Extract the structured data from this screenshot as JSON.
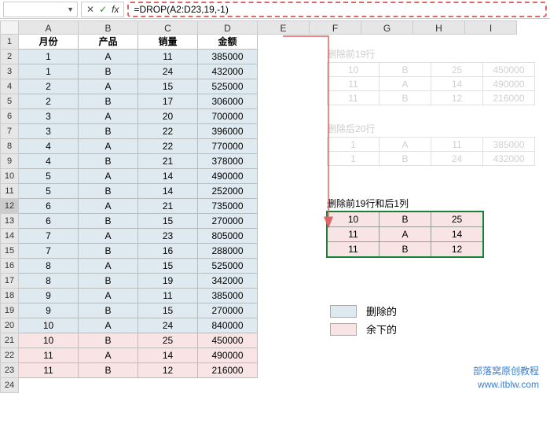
{
  "formula_bar": {
    "name_box": "",
    "fx_label": "fx",
    "formula": "=DROP(A2:D23,19,-1)"
  },
  "col_headers": [
    "A",
    "B",
    "C",
    "D",
    "E",
    "F",
    "G",
    "H",
    "I"
  ],
  "headers": {
    "c1": "月份",
    "c2": "产品",
    "c3": "销量",
    "c4": "金额"
  },
  "main_rows": [
    {
      "m": "1",
      "p": "A",
      "s": "11",
      "a": "385000",
      "cls": "blue"
    },
    {
      "m": "1",
      "p": "B",
      "s": "24",
      "a": "432000",
      "cls": "blue"
    },
    {
      "m": "2",
      "p": "A",
      "s": "15",
      "a": "525000",
      "cls": "blue"
    },
    {
      "m": "2",
      "p": "B",
      "s": "17",
      "a": "306000",
      "cls": "blue"
    },
    {
      "m": "3",
      "p": "A",
      "s": "20",
      "a": "700000",
      "cls": "blue"
    },
    {
      "m": "3",
      "p": "B",
      "s": "22",
      "a": "396000",
      "cls": "blue"
    },
    {
      "m": "4",
      "p": "A",
      "s": "22",
      "a": "770000",
      "cls": "blue"
    },
    {
      "m": "4",
      "p": "B",
      "s": "21",
      "a": "378000",
      "cls": "blue"
    },
    {
      "m": "5",
      "p": "A",
      "s": "14",
      "a": "490000",
      "cls": "blue"
    },
    {
      "m": "5",
      "p": "B",
      "s": "14",
      "a": "252000",
      "cls": "blue"
    },
    {
      "m": "6",
      "p": "A",
      "s": "21",
      "a": "735000",
      "cls": "blue"
    },
    {
      "m": "6",
      "p": "B",
      "s": "15",
      "a": "270000",
      "cls": "blue"
    },
    {
      "m": "7",
      "p": "A",
      "s": "23",
      "a": "805000",
      "cls": "blue"
    },
    {
      "m": "7",
      "p": "B",
      "s": "16",
      "a": "288000",
      "cls": "blue"
    },
    {
      "m": "8",
      "p": "A",
      "s": "15",
      "a": "525000",
      "cls": "blue"
    },
    {
      "m": "8",
      "p": "B",
      "s": "19",
      "a": "342000",
      "cls": "blue"
    },
    {
      "m": "9",
      "p": "A",
      "s": "11",
      "a": "385000",
      "cls": "blue"
    },
    {
      "m": "9",
      "p": "B",
      "s": "15",
      "a": "270000",
      "cls": "blue"
    },
    {
      "m": "10",
      "p": "A",
      "s": "24",
      "a": "840000",
      "cls": "blue"
    },
    {
      "m": "10",
      "p": "B",
      "s": "25",
      "a": "450000",
      "cls": "pink"
    },
    {
      "m": "11",
      "p": "A",
      "s": "14",
      "a": "490000",
      "cls": "pink"
    },
    {
      "m": "11",
      "p": "B",
      "s": "12",
      "a": "216000",
      "cls": "pink"
    }
  ],
  "ghost1": {
    "title": "删除前19行",
    "rows": [
      [
        "10",
        "B",
        "25",
        "450000"
      ],
      [
        "11",
        "A",
        "14",
        "490000"
      ],
      [
        "11",
        "B",
        "12",
        "216000"
      ]
    ]
  },
  "ghost2": {
    "title": "删除后20行",
    "rows": [
      [
        "1",
        "A",
        "11",
        "385000"
      ],
      [
        "1",
        "B",
        "24",
        "432000"
      ]
    ]
  },
  "result": {
    "title": "删除前19行和后1列",
    "rows": [
      [
        "10",
        "B",
        "25"
      ],
      [
        "11",
        "A",
        "14"
      ],
      [
        "11",
        "B",
        "12"
      ]
    ]
  },
  "legend": {
    "l1": "删除的",
    "l2": "余下的"
  },
  "watermark": {
    "l1": "部落窝原创教程",
    "l2": "www.itblw.com"
  }
}
